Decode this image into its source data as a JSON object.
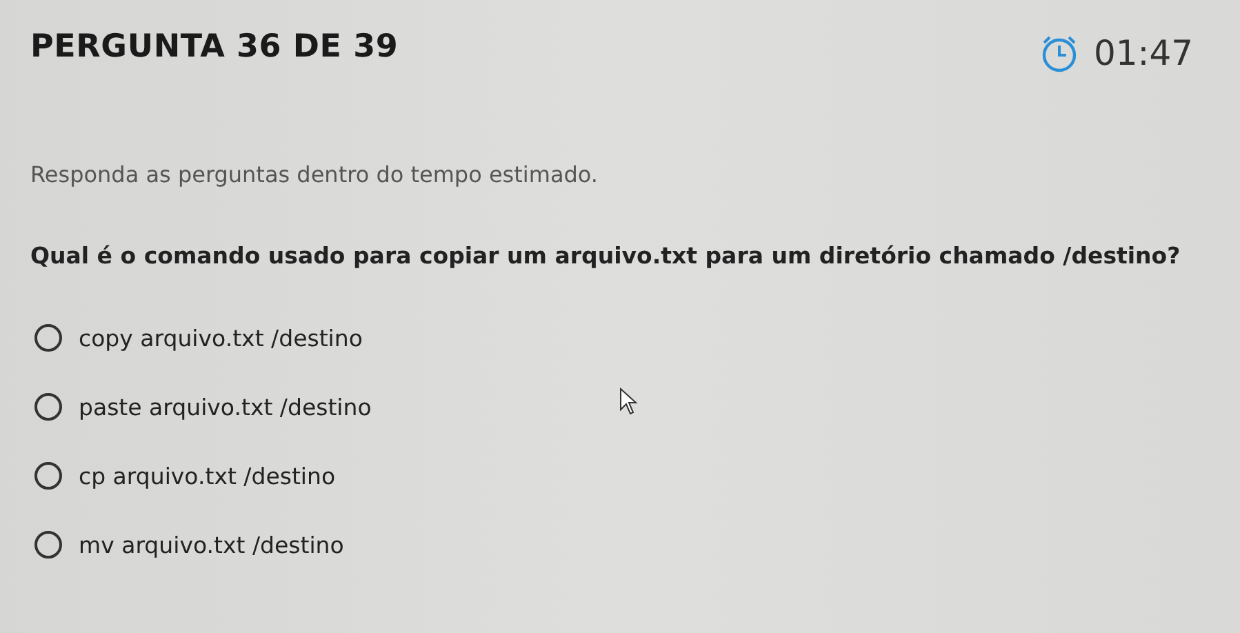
{
  "header": {
    "title": "PERGUNTA 36 DE 39",
    "timer": "01:47"
  },
  "instruction": "Responda as perguntas dentro do tempo estimado.",
  "question": "Qual é o comando usado para copiar um arquivo.txt para um diretório chamado /destino?",
  "options": [
    {
      "label": "copy arquivo.txt /destino",
      "selected": false
    },
    {
      "label": "paste arquivo.txt /destino",
      "selected": false
    },
    {
      "label": "cp arquivo.txt /destino",
      "selected": false
    },
    {
      "label": "mv arquivo.txt /destino",
      "selected": false
    }
  ]
}
